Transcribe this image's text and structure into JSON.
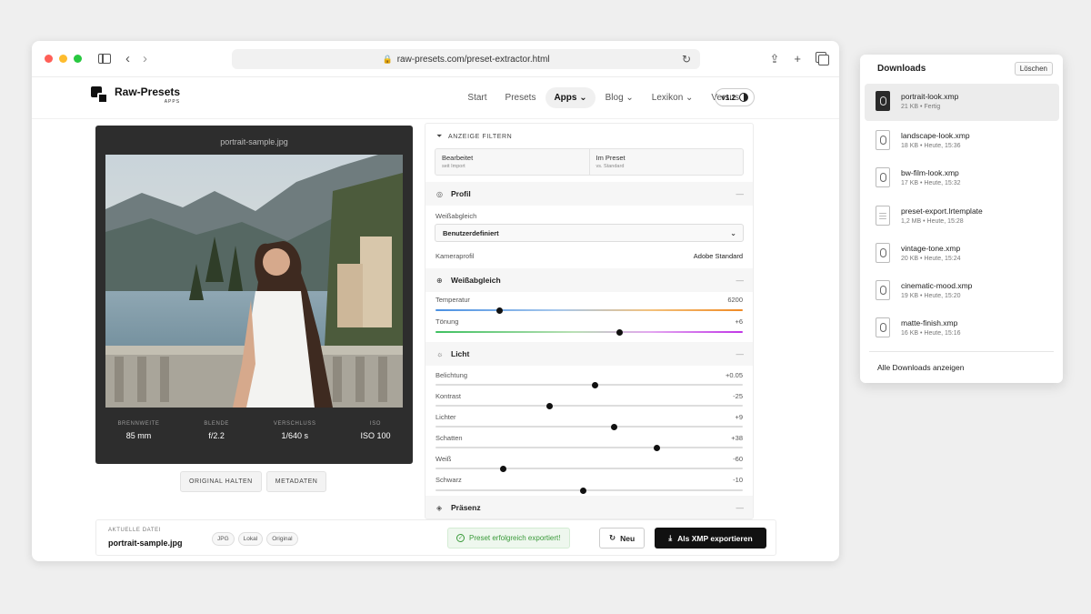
{
  "browser": {
    "url": "raw-presets.com/preset-extractor.html"
  },
  "site": {
    "logo_name": "Raw-Presets",
    "logo_sub": "APPS",
    "nav": [
      {
        "label": "Start"
      },
      {
        "label": "Presets"
      },
      {
        "label": "Apps ⌄"
      },
      {
        "label": "Blog ⌄"
      },
      {
        "label": "Lexikon ⌄"
      },
      {
        "label": "Versus"
      }
    ],
    "version": "v1.2"
  },
  "photo": {
    "filename": "portrait-sample.jpg",
    "exif": [
      {
        "label": "BRENNWEITE",
        "value": "85 mm"
      },
      {
        "label": "BLENDE",
        "value": "f/2.2"
      },
      {
        "label": "VERSCHLUSS",
        "value": "1/640 s"
      },
      {
        "label": "ISO",
        "value": "ISO 100"
      }
    ],
    "buttons": {
      "original": "ORIGINAL HALTEN",
      "metadata": "METADATEN"
    }
  },
  "filter": {
    "title": "ANZEIGE FILTERN",
    "boxes": [
      {
        "main": "Bearbeitet",
        "sub": "seit Import"
      },
      {
        "main": "Im Preset",
        "sub": "vs. Standard"
      }
    ]
  },
  "sections": {
    "profil": {
      "title": "Profil",
      "wb_label": "Weißabgleich",
      "wb_value": "Benutzerdefiniert",
      "camera_label": "Kameraprofil",
      "camera_value": "Adobe Standard"
    },
    "weissabgleich": {
      "title": "Weißabgleich",
      "sliders": [
        {
          "label": "Temperatur",
          "value": "6200",
          "position": 0.21
        },
        {
          "label": "Tönung",
          "value": "+6",
          "position": 0.6
        }
      ]
    },
    "licht": {
      "title": "Licht",
      "sliders": [
        {
          "label": "Belichtung",
          "value": "+0.05",
          "position": 0.52
        },
        {
          "label": "Kontrast",
          "value": "-25",
          "position": 0.37
        },
        {
          "label": "Lichter",
          "value": "+9",
          "position": 0.58
        },
        {
          "label": "Schatten",
          "value": "+38",
          "position": 0.72
        },
        {
          "label": "Weiß",
          "value": "-60",
          "position": 0.22
        },
        {
          "label": "Schwarz",
          "value": "-10",
          "position": 0.48
        }
      ]
    },
    "praesenz": {
      "title": "Präsenz"
    },
    "collapse_symbol": "—"
  },
  "footer": {
    "file_label": "AKTUELLE DATEI",
    "file_name": "portrait-sample.jpg",
    "tags": [
      "JPG",
      "Lokal",
      "Original"
    ],
    "success": "Preset erfolgreich exportiert!",
    "new_label": "Neu",
    "export_label": "Als XMP exportieren"
  },
  "downloads": {
    "title": "Downloads",
    "clear": "Löschen",
    "items": [
      {
        "name": "portrait-look.xmp",
        "meta": "21 KB • Fertig"
      },
      {
        "name": "landscape-look.xmp",
        "meta": "18 KB • Heute, 15:36"
      },
      {
        "name": "bw-film-look.xmp",
        "meta": "17 KB • Heute, 15:32"
      },
      {
        "name": "preset-export.lrtemplate",
        "meta": "1,2 MB • Heute, 15:28"
      },
      {
        "name": "vintage-tone.xmp",
        "meta": "20 KB • Heute, 15:24"
      },
      {
        "name": "cinematic-mood.xmp",
        "meta": "19 KB • Heute, 15:20"
      },
      {
        "name": "matte-finish.xmp",
        "meta": "16 KB • Heute, 15:16"
      }
    ],
    "show_all": "Alle Downloads anzeigen"
  }
}
